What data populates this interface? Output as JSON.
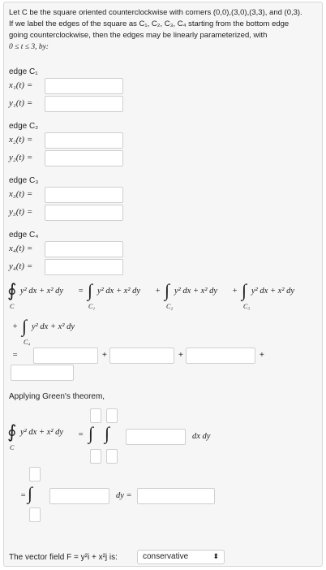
{
  "intro": {
    "line1": "Let C be the square oriented counterclockwise with corners (0,0),(3,0),(3,3), and (0,3).",
    "line2": "If we label the edges of the square as C₁, C₂, C₃, C₄ starting from the bottom edge",
    "line3": "going counterclockwise, then the edges may be linearly parameterized, with",
    "line4": "0 ≤ t ≤ 3, by:"
  },
  "edges": [
    {
      "label": "edge C₁",
      "x": "x₁(t) =",
      "y": "y₁(t) ="
    },
    {
      "label": "edge C₂",
      "x": "x₂(t) =",
      "y": "y₂(t) ="
    },
    {
      "label": "edge C₃",
      "x": "x₃(t) =",
      "y": "y₃(t) ="
    },
    {
      "label": "edge C₄",
      "x": "x₄(t) =",
      "y": "y₄(t) ="
    }
  ],
  "line_integral": {
    "oint": "∮",
    "int": "∫",
    "integrand": "y² dx + x² dy",
    "equals": "=",
    "plus": "+",
    "sub_C": "C",
    "sub_C1": "C₁",
    "sub_C2": "C₂",
    "sub_C3": "C₃",
    "sub_C4": "C₄"
  },
  "greens": {
    "heading": "Applying Green's theorem,",
    "dxdy": "dx dy",
    "dy": "dy =",
    "eq": "="
  },
  "vector_field": {
    "label": "The vector field F = y²i + x²j is:",
    "selected": "conservative",
    "arrow": "⬍"
  }
}
